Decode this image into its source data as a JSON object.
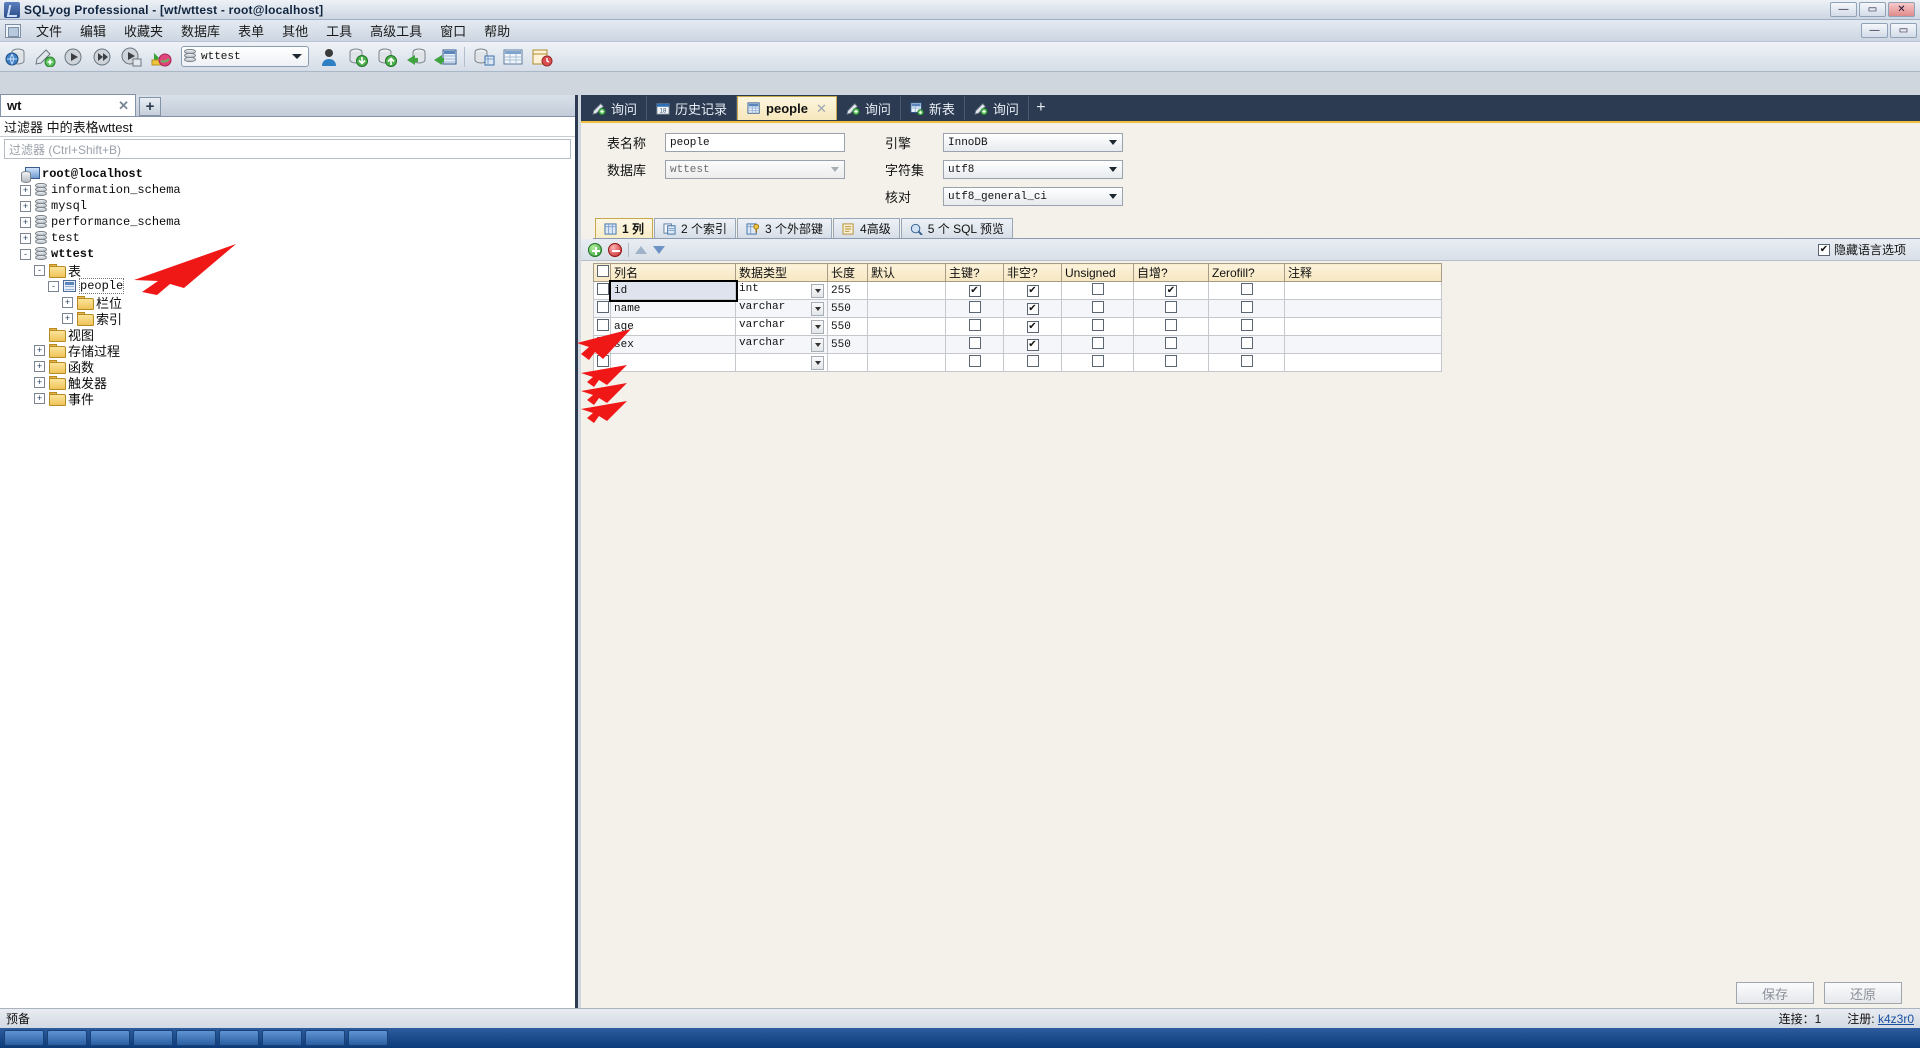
{
  "window": {
    "title": "SQLyog Professional - [wt/wttest - root@localhost]",
    "icon": "sqlyog-icon",
    "minimize": "—",
    "maximize": "▭",
    "close": "✕",
    "restore_small": "▭",
    "min_small": "—"
  },
  "menu": {
    "items": [
      "文件",
      "编辑",
      "收藏夹",
      "数据库",
      "表单",
      "其他",
      "工具",
      "高级工具",
      "窗口",
      "帮助"
    ]
  },
  "toolbar": {
    "db_selector_value": "wttest",
    "buttons": [
      "new-connection-icon",
      "new-query-icon",
      "execute-query-icon",
      "execute-all-icon",
      "execute-current-icon",
      "stop-execute-icon"
    ],
    "buttons_right": [
      "user-manager-icon",
      "import-data-icon",
      "export-data-icon",
      "backup-icon",
      "restore-icon",
      "schema-designer-icon",
      "query-builder-icon",
      "sql-scheduler-icon"
    ]
  },
  "left_pane": {
    "tab_label": "wt",
    "tab_close": "✕",
    "add_tab": "+",
    "filter_header": "过滤器 中的表格wttest",
    "filter_placeholder": "过滤器 (Ctrl+Shift+B)",
    "tree": [
      {
        "label": "root@localhost",
        "indent": 0,
        "toggle": "",
        "icon": "server-icon",
        "bold": true,
        "mono": true
      },
      {
        "label": "information_schema",
        "indent": 1,
        "toggle": "+",
        "icon": "database-icon",
        "bold": false,
        "mono": true
      },
      {
        "label": "mysql",
        "indent": 1,
        "toggle": "+",
        "icon": "database-icon",
        "bold": false,
        "mono": true
      },
      {
        "label": "performance_schema",
        "indent": 1,
        "toggle": "+",
        "icon": "database-icon",
        "bold": false,
        "mono": true
      },
      {
        "label": "test",
        "indent": 1,
        "toggle": "+",
        "icon": "database-icon",
        "bold": false,
        "mono": true
      },
      {
        "label": "wttest",
        "indent": 1,
        "toggle": "-",
        "icon": "database-icon",
        "bold": true,
        "mono": true
      },
      {
        "label": "表",
        "indent": 2,
        "toggle": "-",
        "icon": "folder-icon",
        "bold": false,
        "mono": false
      },
      {
        "label": "people",
        "indent": 3,
        "toggle": "-",
        "icon": "table-icon",
        "bold": false,
        "mono": true,
        "selected": true
      },
      {
        "label": "栏位",
        "indent": 4,
        "toggle": "+",
        "icon": "folder-icon",
        "bold": false,
        "mono": false
      },
      {
        "label": "索引",
        "indent": 4,
        "toggle": "+",
        "icon": "folder-icon",
        "bold": false,
        "mono": false
      },
      {
        "label": "视图",
        "indent": 2,
        "toggle": "",
        "icon": "folder-icon",
        "bold": false,
        "mono": false
      },
      {
        "label": "存储过程",
        "indent": 2,
        "toggle": "+",
        "icon": "folder-icon",
        "bold": false,
        "mono": false
      },
      {
        "label": "函数",
        "indent": 2,
        "toggle": "+",
        "icon": "folder-icon",
        "bold": false,
        "mono": false
      },
      {
        "label": "触发器",
        "indent": 2,
        "toggle": "+",
        "icon": "folder-icon",
        "bold": false,
        "mono": false
      },
      {
        "label": "事件",
        "indent": 2,
        "toggle": "+",
        "icon": "folder-icon",
        "bold": false,
        "mono": false
      }
    ]
  },
  "editor_tabs": [
    {
      "label": "询问",
      "icon": "query-icon",
      "active": false,
      "closable": false
    },
    {
      "label": "历史记录",
      "icon": "history-icon",
      "active": false,
      "closable": false
    },
    {
      "label": "people",
      "icon": "table-icon",
      "active": true,
      "closable": true,
      "close": "✕"
    },
    {
      "label": "询问",
      "icon": "query-icon",
      "active": false,
      "closable": false
    },
    {
      "label": "新表",
      "icon": "newtable-icon",
      "active": false,
      "closable": false
    },
    {
      "label": "询问",
      "icon": "query-icon",
      "active": false,
      "closable": false
    }
  ],
  "editor_tabs_add": "+",
  "table_form": {
    "name_label": "表名称",
    "name_value": "people",
    "db_label": "数据库",
    "db_value": "wttest",
    "engine_label": "引擎",
    "engine_value": "InnoDB",
    "charset_label": "字符集",
    "charset_value": "utf8",
    "collation_label": "核对",
    "collation_value": "utf8_general_ci"
  },
  "sub_tabs": [
    {
      "label": "1 列",
      "icon": "columns-icon",
      "active": true
    },
    {
      "label": "2 个索引",
      "icon": "index-icon",
      "active": false
    },
    {
      "label": "3 个外部键",
      "icon": "foreignkey-icon",
      "active": false
    },
    {
      "label": "4高级",
      "icon": "advanced-icon",
      "active": false
    },
    {
      "label": "5 个 SQL 预览",
      "icon": "sqlpreview-icon",
      "active": false
    }
  ],
  "grid_toolbar": {
    "add": "add-row-icon",
    "remove": "remove-row-icon",
    "move_up": "move-up-icon",
    "move_down": "move-down-icon",
    "hide_lang_label": "隐藏语言选项",
    "hide_lang_checked": true,
    "check_glyph": "✔"
  },
  "grid": {
    "headers": [
      "",
      "列名",
      "数据类型",
      "长度",
      "默认",
      "主键?",
      "非空?",
      "Unsigned",
      "自增?",
      "Zerofill?",
      "注释"
    ],
    "rows": [
      {
        "name": "id",
        "type": "int",
        "length": "255",
        "default": "",
        "pk": true,
        "notnull": true,
        "unsigned": false,
        "autoinc": true,
        "zerofill": false,
        "comment": "",
        "selected": true
      },
      {
        "name": "name",
        "type": "varchar",
        "length": "550",
        "default": "",
        "pk": false,
        "notnull": true,
        "unsigned": false,
        "autoinc": false,
        "zerofill": false,
        "comment": "",
        "selected": false
      },
      {
        "name": "age",
        "type": "varchar",
        "length": "550",
        "default": "",
        "pk": false,
        "notnull": true,
        "unsigned": false,
        "autoinc": false,
        "zerofill": false,
        "comment": "",
        "selected": false
      },
      {
        "name": "sex",
        "type": "varchar",
        "length": "550",
        "default": "",
        "pk": false,
        "notnull": true,
        "unsigned": false,
        "autoinc": false,
        "zerofill": false,
        "comment": "",
        "selected": false
      },
      {
        "name": "",
        "type": "",
        "length": "",
        "default": "",
        "pk": false,
        "notnull": false,
        "unsigned": false,
        "autoinc": false,
        "zerofill": false,
        "comment": "",
        "selected": false
      }
    ]
  },
  "footer_buttons": {
    "save": "保存",
    "revert": "还原"
  },
  "status_bar": {
    "left": "预备",
    "connection_label": "连接：1",
    "register_label": "注册:",
    "register_value": "k4z3r0"
  }
}
